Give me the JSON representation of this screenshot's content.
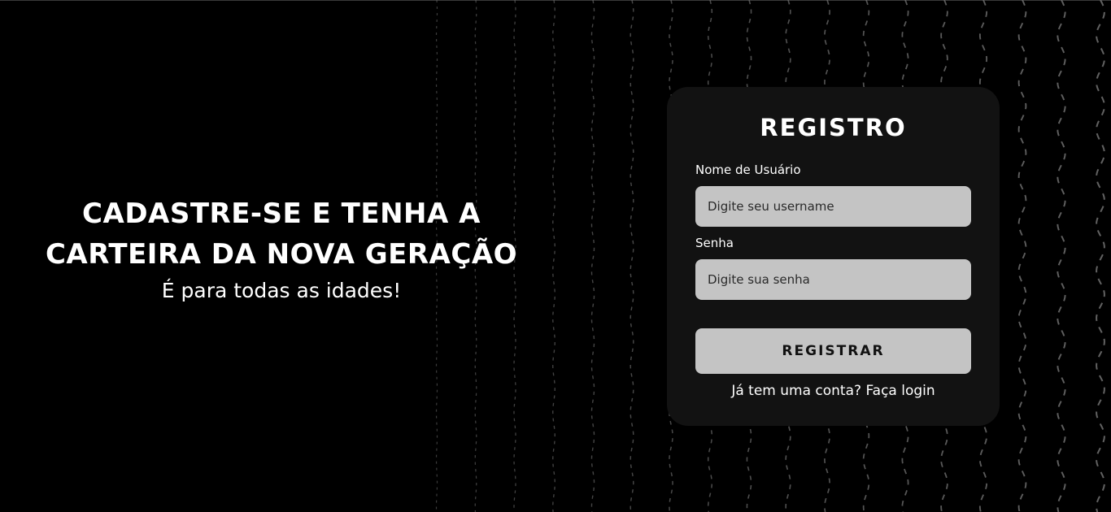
{
  "hero": {
    "title_line1": "CADASTRE-SE E TENHA A",
    "title_line2": "CARTEIRA DA NOVA GERAÇÃO",
    "subtitle": "É para todas as idades!"
  },
  "form": {
    "title": "REGISTRO",
    "username_label": "Nome de Usuário",
    "username_placeholder": "Digite seu username",
    "username_value": "",
    "password_label": "Senha",
    "password_placeholder": "Digite sua senha",
    "password_value": "",
    "submit_label": "REGISTRAR",
    "login_link": "Já tem uma conta? Faça login"
  },
  "colors": {
    "background": "#000000",
    "card": "#121212",
    "input": "#c4c4c4",
    "pattern": "#6e6e6e"
  }
}
